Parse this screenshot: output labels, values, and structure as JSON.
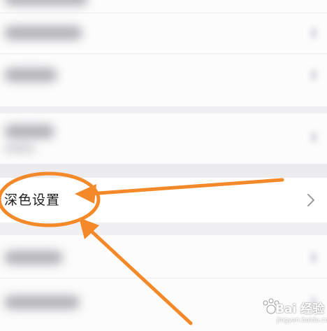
{
  "settings": {
    "dark_mode_row": {
      "label": "深色设置",
      "chevron_icon": "chevron-right-icon"
    }
  },
  "annotation": {
    "accent_color": "#f4892a",
    "circle_target": "深色设置",
    "arrow_count": 2
  },
  "watermark": {
    "brand": "Bai 经验",
    "domain": "jingyan.baidu.com"
  }
}
